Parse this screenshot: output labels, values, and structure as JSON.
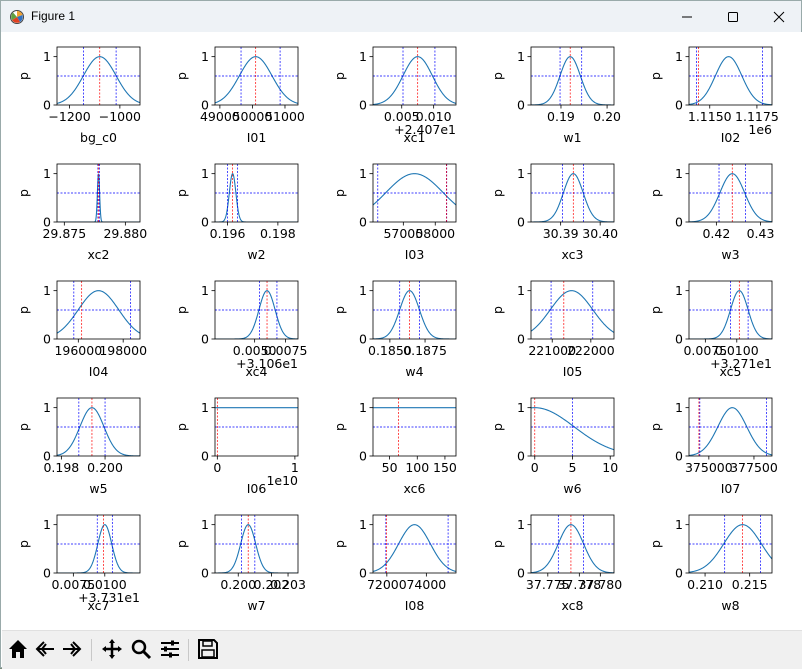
{
  "window": {
    "title": "Figure 1",
    "controls": [
      "minimize-icon",
      "maximize-icon",
      "close-icon"
    ]
  },
  "toolbar": {
    "buttons": [
      "home-icon",
      "back-icon",
      "forward-icon",
      "pan-icon",
      "zoom-icon",
      "configure-subplots-icon",
      "save-icon"
    ]
  },
  "colors": {
    "curve": "#1f77b4",
    "blue_lines": "#0000ff",
    "red_line": "#ff0000"
  },
  "chart_data": [
    {
      "type": "line",
      "xlabel": "bg_c0",
      "ylabel": "p",
      "xlim": [
        -1250,
        -920
      ],
      "ylim": [
        0,
        1.2
      ],
      "xticks": [
        -1200,
        -1000
      ],
      "xtick_labels": [
        "−1200",
        "−1000"
      ],
      "yticks": [
        0,
        1
      ],
      "ytick_labels": [
        "0",
        "1"
      ],
      "offset_text": "",
      "curve": {
        "kind": "gauss",
        "mu": -1080,
        "sigma": 65
      },
      "hline": 0.6,
      "vlines_blue": [
        -1145,
        -1015
      ],
      "vline_red": -1080
    },
    {
      "type": "line",
      "xlabel": "I01",
      "ylabel": "p",
      "xlim": [
        48850,
        51400
      ],
      "ylim": [
        0,
        1.2
      ],
      "xticks": [
        49000,
        50000,
        51000
      ],
      "xtick_labels": [
        "49000",
        "50000",
        "51000"
      ],
      "yticks": [
        0,
        1
      ],
      "ytick_labels": [
        "0",
        "1"
      ],
      "offset_text": "",
      "curve": {
        "kind": "gauss",
        "mu": 50100,
        "sigma": 500
      },
      "hline": 0.6,
      "vlines_blue": [
        49650,
        50850
      ],
      "vline_red": 50100
    },
    {
      "type": "line",
      "xlabel": "xc1",
      "ylabel": "p",
      "xlim": [
        0.0005,
        0.0135
      ],
      "ylim": [
        0,
        1.2
      ],
      "xticks": [
        0.005,
        0.01
      ],
      "xtick_labels": [
        "0.005",
        "0.010"
      ],
      "yticks": [
        0,
        1
      ],
      "ytick_labels": [
        "0",
        "1"
      ],
      "offset_text": "+2.407e1",
      "curve": {
        "kind": "gauss",
        "mu": 0.0075,
        "sigma": 0.0023
      },
      "hline": 0.6,
      "vlines_blue": [
        0.0052,
        0.0102
      ],
      "vline_red": 0.0075
    },
    {
      "type": "line",
      "xlabel": "w1",
      "ylabel": "p",
      "xlim": [
        0.1835,
        0.2015
      ],
      "ylim": [
        0,
        1.2
      ],
      "xticks": [
        0.19,
        0.2
      ],
      "xtick_labels": [
        "0.19",
        "0.20"
      ],
      "yticks": [
        0,
        1
      ],
      "ytick_labels": [
        "0",
        "1"
      ],
      "offset_text": "",
      "curve": {
        "kind": "gauss",
        "mu": 0.192,
        "sigma": 0.0022
      },
      "hline": 0.6,
      "vlines_blue": [
        0.1898,
        0.1945
      ],
      "vline_red": 0.192
    },
    {
      "type": "line",
      "xlabel": "I02",
      "ylabel": "p",
      "xlim": [
        1113900,
        1118300
      ],
      "ylim": [
        0,
        1.2
      ],
      "xticks": [
        1115000,
        1117500
      ],
      "xtick_labels": [
        "1.1150",
        "1.1175"
      ],
      "yticks": [
        0,
        1
      ],
      "ytick_labels": [
        "0",
        "1"
      ],
      "offset_text": "1e6",
      "curve": {
        "kind": "gauss",
        "mu": 1116000,
        "sigma": 700
      },
      "hline": 0.6,
      "vlines_blue": [
        1114300,
        1117800
      ],
      "vline_red": 1114400
    },
    {
      "type": "line",
      "xlabel": "xc2",
      "ylabel": "p",
      "xlim": [
        29.8744,
        29.8812
      ],
      "ylim": [
        0,
        1.2
      ],
      "xticks": [
        29.875,
        29.88
      ],
      "xtick_labels": [
        "29.875",
        "29.880"
      ],
      "yticks": [
        0,
        1
      ],
      "ytick_labels": [
        "0",
        "1"
      ],
      "offset_text": "",
      "curve": {
        "kind": "gauss",
        "mu": 29.8778,
        "sigma": 9e-05
      },
      "hline": 0.6,
      "vlines_blue": [
        29.87775,
        29.87788
      ],
      "vline_red": 29.8778
    },
    {
      "type": "line",
      "xlabel": "w2",
      "ylabel": "p",
      "xlim": [
        0.1955,
        0.1988
      ],
      "ylim": [
        0,
        1.2
      ],
      "xticks": [
        0.196,
        0.198
      ],
      "xtick_labels": [
        "0.196",
        "0.198"
      ],
      "yticks": [
        0,
        1
      ],
      "ytick_labels": [
        "0",
        "1"
      ],
      "offset_text": "",
      "curve": {
        "kind": "gauss",
        "mu": 0.1962,
        "sigma": 0.00013
      },
      "hline": 0.6,
      "vlines_blue": [
        0.196,
        0.1964
      ],
      "vline_red": 0.1962
    },
    {
      "type": "line",
      "xlabel": "I03",
      "ylabel": "p",
      "xlim": [
        56050,
        58650
      ],
      "ylim": [
        0,
        1.2
      ],
      "xticks": [
        57000,
        58000
      ],
      "xtick_labels": [
        "57000",
        "58000"
      ],
      "yticks": [
        0,
        1
      ],
      "ytick_labels": [
        "0",
        "1"
      ],
      "offset_text": "",
      "curve": {
        "kind": "gauss",
        "mu": 57350,
        "sigma": 900
      },
      "hline": 0.6,
      "vlines_blue": [
        56200,
        58360
      ],
      "vline_red": 58350
    },
    {
      "type": "line",
      "xlabel": "xc3",
      "ylabel": "p",
      "xlim": [
        30.3825,
        30.4035
      ],
      "ylim": [
        0,
        1.2
      ],
      "xticks": [
        30.39,
        30.4
      ],
      "xtick_labels": [
        "30.39",
        "30.40"
      ],
      "yticks": [
        0,
        1
      ],
      "ytick_labels": [
        "0",
        "1"
      ],
      "offset_text": "",
      "curve": {
        "kind": "gauss",
        "mu": 30.3932,
        "sigma": 0.0025
      },
      "hline": 0.6,
      "vlines_blue": [
        30.3905,
        30.3958
      ],
      "vline_red": 30.3932
    },
    {
      "type": "line",
      "xlabel": "w3",
      "ylabel": "p",
      "xlim": [
        0.4138,
        0.4326
      ],
      "ylim": [
        0,
        1.2
      ],
      "xticks": [
        0.42,
        0.43
      ],
      "xtick_labels": [
        "0.42",
        "0.43"
      ],
      "yticks": [
        0,
        1
      ],
      "ytick_labels": [
        "0",
        "1"
      ],
      "offset_text": "",
      "curve": {
        "kind": "gauss",
        "mu": 0.4236,
        "sigma": 0.0028
      },
      "hline": 0.6,
      "vlines_blue": [
        0.4206,
        0.4266
      ],
      "vline_red": 0.4236
    },
    {
      "type": "line",
      "xlabel": "I04",
      "ylabel": "p",
      "xlim": [
        195050,
        198750
      ],
      "ylim": [
        0,
        1.2
      ],
      "xticks": [
        196000,
        198000
      ],
      "xtick_labels": [
        "196000",
        "198000"
      ],
      "yticks": [
        0,
        1
      ],
      "ytick_labels": [
        "0",
        "1"
      ],
      "offset_text": "",
      "curve": {
        "kind": "gauss",
        "mu": 196900,
        "sigma": 900
      },
      "hline": 0.6,
      "vlines_blue": [
        195800,
        198320
      ],
      "vline_red": 196150
    },
    {
      "type": "line",
      "xlabel": "xc4",
      "ylabel": "p",
      "xlim": [
        0.0018,
        0.0085
      ],
      "ylim": [
        0,
        1.2
      ],
      "xticks": [
        0.005,
        0.0075
      ],
      "xtick_labels": [
        "0.0050",
        "0.0075"
      ],
      "yticks": [
        0,
        1
      ],
      "ytick_labels": [
        "0",
        "1"
      ],
      "offset_text": "+3.106e1",
      "curve": {
        "kind": "gauss",
        "mu": 0.006,
        "sigma": 0.00065
      },
      "hline": 0.6,
      "vlines_blue": [
        0.0054,
        0.0068
      ],
      "vline_red": 0.006
    },
    {
      "type": "line",
      "xlabel": "w4",
      "ylabel": "p",
      "xlim": [
        0.1838,
        0.1897
      ],
      "ylim": [
        0,
        1.2
      ],
      "xticks": [
        0.185,
        0.1875
      ],
      "xtick_labels": [
        "0.1850",
        "0.1875"
      ],
      "yticks": [
        0,
        1
      ],
      "ytick_labels": [
        "0",
        "1"
      ],
      "offset_text": "",
      "curve": {
        "kind": "gauss",
        "mu": 0.1864,
        "sigma": 0.0007
      },
      "hline": 0.6,
      "vlines_blue": [
        0.1857,
        0.1871
      ],
      "vline_red": 0.1864
    },
    {
      "type": "line",
      "xlabel": "I05",
      "ylabel": "p",
      "xlim": [
        220450,
        222600
      ],
      "ylim": [
        0,
        1.2
      ],
      "xticks": [
        221000,
        222000
      ],
      "xtick_labels": [
        "221000",
        "222000"
      ],
      "yticks": [
        0,
        1
      ],
      "ytick_labels": [
        "0",
        "1"
      ],
      "offset_text": "",
      "curve": {
        "kind": "gauss",
        "mu": 221500,
        "sigma": 550
      },
      "hline": 0.6,
      "vlines_blue": [
        220970,
        222050
      ],
      "vline_red": 221300
    },
    {
      "type": "line",
      "xlabel": "xc5",
      "ylabel": "p",
      "xlim": [
        0.0062,
        0.0128
      ],
      "ylim": [
        0,
        1.2
      ],
      "xticks": [
        0.0075,
        0.01
      ],
      "xtick_labels": [
        "0.0075",
        "0.0100"
      ],
      "yticks": [
        0,
        1
      ],
      "ytick_labels": [
        "0",
        "1"
      ],
      "offset_text": "+3.271e1",
      "curve": {
        "kind": "gauss",
        "mu": 0.0102,
        "sigma": 0.0007
      },
      "hline": 0.6,
      "vlines_blue": [
        0.0095,
        0.0109
      ],
      "vline_red": 0.0102
    },
    {
      "type": "line",
      "xlabel": "w5",
      "ylabel": "p",
      "xlim": [
        0.1978,
        0.2016
      ],
      "ylim": [
        0,
        1.2
      ],
      "xticks": [
        0.198,
        0.2
      ],
      "xtick_labels": [
        "0.198",
        "0.200"
      ],
      "yticks": [
        0,
        1
      ],
      "ytick_labels": [
        "0",
        "1"
      ],
      "offset_text": "",
      "curve": {
        "kind": "gauss",
        "mu": 0.1994,
        "sigma": 0.00055
      },
      "hline": 0.6,
      "vlines_blue": [
        0.1988,
        0.2
      ],
      "vline_red": 0.1994
    },
    {
      "type": "line",
      "xlabel": "I06",
      "ylabel": "p",
      "xlim": [
        -300000000.0,
        10400000000.0
      ],
      "ylim": [
        0,
        1.2
      ],
      "xticks": [
        0,
        10000000000
      ],
      "xtick_labels": [
        "0",
        "1"
      ],
      "yticks": [
        0,
        1
      ],
      "ytick_labels": [
        "0",
        "1"
      ],
      "offset_text": "1e10",
      "curve": {
        "kind": "flat",
        "value": 1.0
      },
      "hline": 0.6,
      "vlines_blue": [],
      "vline_red": 0
    },
    {
      "type": "line",
      "xlabel": "xc6",
      "ylabel": "p",
      "xlim": [
        20,
        170
      ],
      "ylim": [
        0,
        1.2
      ],
      "xticks": [
        50,
        100,
        150
      ],
      "xtick_labels": [
        "50",
        "100",
        "150"
      ],
      "yticks": [
        0,
        1
      ],
      "ytick_labels": [
        "0",
        "1"
      ],
      "offset_text": "",
      "curve": {
        "kind": "flat",
        "value": 1.0
      },
      "hline": 0.6,
      "vlines_blue": [],
      "vline_red": 66
    },
    {
      "type": "line",
      "xlabel": "w6",
      "ylabel": "p",
      "xlim": [
        -0.5,
        10.5
      ],
      "ylim": [
        0,
        1.2
      ],
      "xticks": [
        0,
        5,
        10
      ],
      "xtick_labels": [
        "0",
        "5",
        "10"
      ],
      "yticks": [
        0,
        1
      ],
      "ytick_labels": [
        "0",
        "1"
      ],
      "offset_text": "",
      "curve": {
        "kind": "gauss",
        "mu": 0,
        "sigma": 5.2
      },
      "hline": 0.6,
      "vlines_blue": [
        5
      ],
      "vline_red": 0
    },
    {
      "type": "line",
      "xlabel": "I07",
      "ylabel": "p",
      "xlim": [
        373900,
        378500
      ],
      "ylim": [
        0,
        1.2
      ],
      "xticks": [
        375000,
        377500
      ],
      "xtick_labels": [
        "375000",
        "377500"
      ],
      "yticks": [
        0,
        1
      ],
      "ytick_labels": [
        "0",
        "1"
      ],
      "offset_text": "",
      "curve": {
        "kind": "gauss",
        "mu": 376300,
        "sigma": 800
      },
      "hline": 0.6,
      "vlines_blue": [
        374500,
        378200
      ],
      "vline_red": 374450
    },
    {
      "type": "line",
      "xlabel": "xc7",
      "ylabel": "p",
      "xlim": [
        0.0062,
        0.0128
      ],
      "ylim": [
        0,
        1.2
      ],
      "xticks": [
        0.0075,
        0.01
      ],
      "xtick_labels": [
        "0.0075",
        "0.0100"
      ],
      "yticks": [
        0,
        1
      ],
      "ytick_labels": [
        "0",
        "1"
      ],
      "offset_text": "+3.731e1",
      "curve": {
        "kind": "gauss",
        "mu": 0.01,
        "sigma": 0.00055
      },
      "hline": 0.6,
      "vlines_blue": [
        0.0094,
        0.0106
      ],
      "vline_red": 0.0099
    },
    {
      "type": "line",
      "xlabel": "w7",
      "ylabel": "p",
      "xlim": [
        0.1986,
        0.2036
      ],
      "ylim": [
        0,
        1.2
      ],
      "xticks": [
        0.2,
        0.202,
        0.203
      ],
      "xtick_labels": [
        "0.200",
        "0.202",
        "0.203"
      ],
      "yticks": [
        0,
        1
      ],
      "ytick_labels": [
        "0",
        "1"
      ],
      "offset_text": "",
      "curve": {
        "kind": "gauss",
        "mu": 0.2006,
        "sigma": 0.00045
      },
      "hline": 0.6,
      "vlines_blue": [
        0.2002,
        0.201
      ],
      "vline_red": 0.2006
    },
    {
      "type": "line",
      "xlabel": "I08",
      "ylabel": "p",
      "xlim": [
        71300,
        75500
      ],
      "ylim": [
        0,
        1.2
      ],
      "xticks": [
        72000,
        74000
      ],
      "xtick_labels": [
        "72000",
        "74000"
      ],
      "yticks": [
        0,
        1
      ],
      "ytick_labels": [
        "0",
        "1"
      ],
      "offset_text": "",
      "curve": {
        "kind": "gauss",
        "mu": 73400,
        "sigma": 800
      },
      "hline": 0.6,
      "vlines_blue": [
        71950,
        75100
      ],
      "vline_red": 71980
    },
    {
      "type": "line",
      "xlabel": "xc8",
      "ylabel": "p",
      "xlim": [
        37.7734,
        37.7813
      ],
      "ylim": [
        0,
        1.2
      ],
      "xticks": [
        37.775,
        37.778,
        37.78
      ],
      "xtick_labels": [
        "37.775",
        "37.778",
        "37.780"
      ],
      "yticks": [
        0,
        1
      ],
      "ytick_labels": [
        "0",
        "1"
      ],
      "offset_text": "",
      "curve": {
        "kind": "gauss",
        "mu": 37.7772,
        "sigma": 0.0012
      },
      "hline": 0.6,
      "vlines_blue": [
        37.776,
        37.7784
      ],
      "vline_red": 37.7772
    },
    {
      "type": "line",
      "xlabel": "w8",
      "ylabel": "p",
      "xlim": [
        0.2082,
        0.2175
      ],
      "ylim": [
        0,
        1.2
      ],
      "xticks": [
        0.21,
        0.215
      ],
      "xtick_labels": [
        "0.210",
        "0.215"
      ],
      "yticks": [
        0,
        1
      ],
      "ytick_labels": [
        "0",
        "1"
      ],
      "offset_text": "",
      "curve": {
        "kind": "gauss",
        "mu": 0.2142,
        "sigma": 0.0021
      },
      "hline": 0.6,
      "vlines_blue": [
        0.2122,
        0.2162
      ],
      "vline_red": 0.2142
    }
  ]
}
